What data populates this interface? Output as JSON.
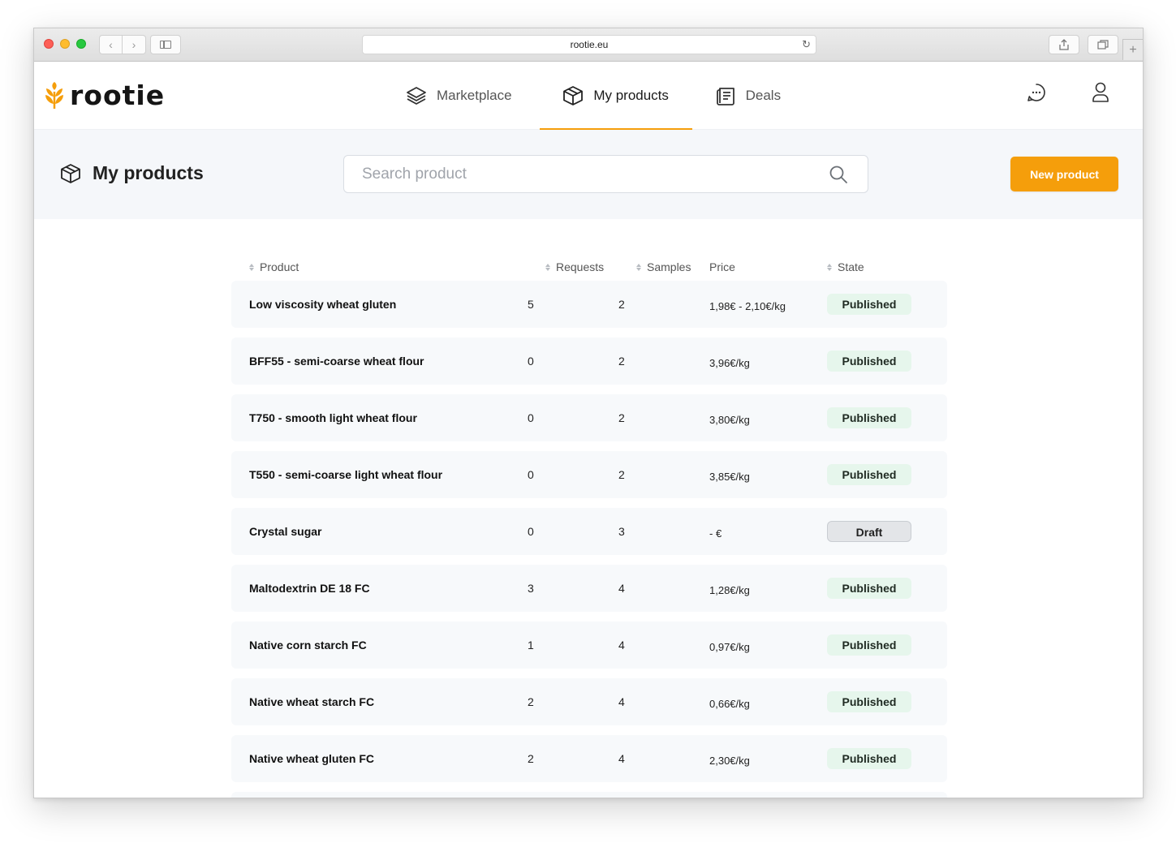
{
  "browser": {
    "url": "rootie.eu"
  },
  "app": {
    "logo_text": "rootie",
    "brand_color": "#f59e0b"
  },
  "nav": {
    "items": [
      {
        "label": "Marketplace",
        "icon": "layers-icon",
        "active": false
      },
      {
        "label": "My products",
        "icon": "package-icon",
        "active": true
      },
      {
        "label": "Deals",
        "icon": "documents-icon",
        "active": false
      }
    ]
  },
  "header_actions": {
    "chat_icon": "chat-icon",
    "user_icon": "user-icon"
  },
  "page": {
    "title": "My products",
    "search_placeholder": "Search product",
    "new_button": "New product"
  },
  "table": {
    "columns": [
      "Product",
      "Requests",
      "Samples",
      "Price",
      "State"
    ],
    "rows": [
      {
        "product": "Low viscosity wheat gluten",
        "requests": "5",
        "samples": "2",
        "price": "1,98€ - 2,10€/kg",
        "state": "Published"
      },
      {
        "product": "BFF55 - semi-coarse wheat flour",
        "requests": "0",
        "samples": "2",
        "price": "3,96€/kg",
        "state": "Published"
      },
      {
        "product": "T750 - smooth light wheat flour",
        "requests": "0",
        "samples": "2",
        "price": "3,80€/kg",
        "state": "Published"
      },
      {
        "product": "T550 - semi-coarse light wheat flour",
        "requests": "0",
        "samples": "2",
        "price": "3,85€/kg",
        "state": "Published"
      },
      {
        "product": "Crystal sugar",
        "requests": "0",
        "samples": "3",
        "price": "- €",
        "state": "Draft"
      },
      {
        "product": "Maltodextrin DE 18 FC",
        "requests": "3",
        "samples": "4",
        "price": "1,28€/kg",
        "state": "Published"
      },
      {
        "product": "Native corn starch FC",
        "requests": "1",
        "samples": "4",
        "price": "0,97€/kg",
        "state": "Published"
      },
      {
        "product": "Native wheat starch FC",
        "requests": "2",
        "samples": "4",
        "price": "0,66€/kg",
        "state": "Published"
      },
      {
        "product": "Native wheat gluten FC",
        "requests": "2",
        "samples": "4",
        "price": "2,30€/kg",
        "state": "Published"
      }
    ]
  }
}
